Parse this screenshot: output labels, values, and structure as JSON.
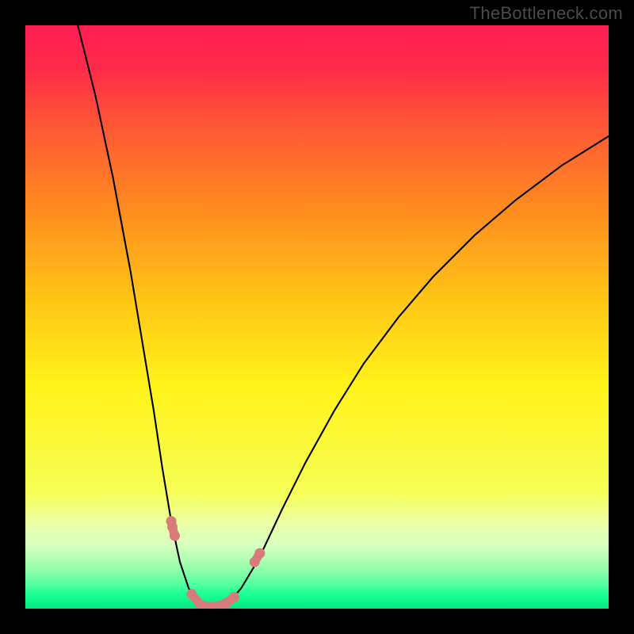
{
  "watermark": "TheBottleneck.com",
  "chart_data": {
    "type": "line",
    "title": "",
    "xlabel": "",
    "ylabel": "",
    "xlim": [
      0,
      100
    ],
    "ylim": [
      0,
      100
    ],
    "background_gradient": {
      "stops": [
        {
          "offset": 0.0,
          "color": "#ff1f52"
        },
        {
          "offset": 0.07,
          "color": "#ff2a4a"
        },
        {
          "offset": 0.18,
          "color": "#ff5a34"
        },
        {
          "offset": 0.32,
          "color": "#ff8d1f"
        },
        {
          "offset": 0.48,
          "color": "#ffc916"
        },
        {
          "offset": 0.62,
          "color": "#fff31a"
        },
        {
          "offset": 0.8,
          "color": "#f6ff55"
        },
        {
          "offset": 0.85,
          "color": "#ecffa0"
        },
        {
          "offset": 0.89,
          "color": "#d7ffc0"
        },
        {
          "offset": 0.92,
          "color": "#aaffb1"
        },
        {
          "offset": 0.955,
          "color": "#5dffa0"
        },
        {
          "offset": 0.975,
          "color": "#1bff94"
        },
        {
          "offset": 1.0,
          "color": "#00e884"
        }
      ]
    },
    "series": [
      {
        "name": "bottleneck-curve",
        "stroke": "#000000",
        "stroke_width": 2.1,
        "points": [
          {
            "x": 9.0,
            "y": 100.0
          },
          {
            "x": 12.0,
            "y": 88.0
          },
          {
            "x": 15.0,
            "y": 74.0
          },
          {
            "x": 18.0,
            "y": 58.0
          },
          {
            "x": 20.0,
            "y": 46.0
          },
          {
            "x": 22.0,
            "y": 34.0
          },
          {
            "x": 23.5,
            "y": 24.0
          },
          {
            "x": 25.0,
            "y": 15.0
          },
          {
            "x": 26.5,
            "y": 8.0
          },
          {
            "x": 28.0,
            "y": 3.5
          },
          {
            "x": 29.5,
            "y": 1.0
          },
          {
            "x": 31.0,
            "y": 0.3
          },
          {
            "x": 33.0,
            "y": 0.3
          },
          {
            "x": 35.0,
            "y": 1.2
          },
          {
            "x": 37.0,
            "y": 3.5
          },
          {
            "x": 40.0,
            "y": 8.5
          },
          {
            "x": 44.0,
            "y": 17.0
          },
          {
            "x": 48.0,
            "y": 25.0
          },
          {
            "x": 53.0,
            "y": 34.0
          },
          {
            "x": 58.0,
            "y": 42.0
          },
          {
            "x": 64.0,
            "y": 50.0
          },
          {
            "x": 70.0,
            "y": 57.0
          },
          {
            "x": 77.0,
            "y": 64.0
          },
          {
            "x": 84.0,
            "y": 70.0
          },
          {
            "x": 92.0,
            "y": 76.0
          },
          {
            "x": 100.0,
            "y": 81.0
          }
        ]
      },
      {
        "name": "markers-left",
        "stroke": "#d87b7b",
        "stroke_width": 11,
        "marker_radius": 6.5,
        "points": [
          {
            "x": 25.0,
            "y": 15.0
          },
          {
            "x": 25.2,
            "y": 14.0
          },
          {
            "x": 25.6,
            "y": 12.5
          }
        ]
      },
      {
        "name": "markers-bottom",
        "stroke": "#d87b7b",
        "stroke_width": 11,
        "marker_radius": 6.5,
        "points": [
          {
            "x": 28.5,
            "y": 2.5
          },
          {
            "x": 30.0,
            "y": 0.7
          },
          {
            "x": 31.5,
            "y": 0.3
          },
          {
            "x": 33.0,
            "y": 0.4
          },
          {
            "x": 34.5,
            "y": 1.0
          },
          {
            "x": 35.8,
            "y": 2.0
          }
        ]
      },
      {
        "name": "markers-right",
        "stroke": "#d87b7b",
        "stroke_width": 11,
        "marker_radius": 6.5,
        "points": [
          {
            "x": 39.3,
            "y": 8.0
          },
          {
            "x": 40.2,
            "y": 9.5
          }
        ]
      }
    ]
  }
}
